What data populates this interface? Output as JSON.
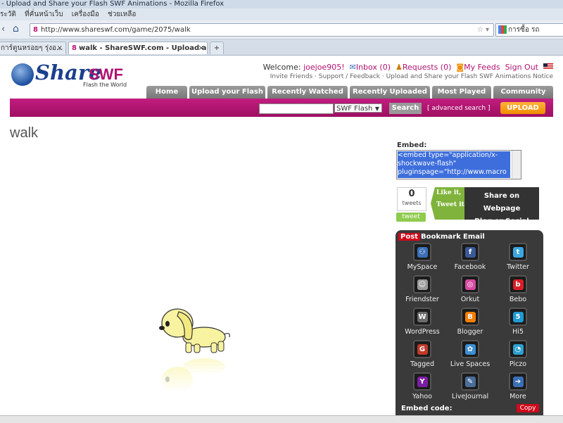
{
  "browser": {
    "title": "- Upload and Share your Flash SWF Animations - Mozilla Firefox",
    "menu": [
      "ระวัติ",
      "ที่คั่นหน้าเว็บ",
      "เครื่องมือ",
      "ช่วยเหลือ"
    ],
    "url": "http://www.shareswf.com/game/2075/walk",
    "search_text": "การซื้อ รถ",
    "tabs": [
      {
        "label": "การ์ตูนหรอยๆ รุ่งอ..."
      },
      {
        "label": "walk - ShareSWF.com - Upload an..."
      }
    ],
    "new_tab": "+"
  },
  "site": {
    "logo_share": "Share",
    "logo_swf": "SWF",
    "tagline": "Flash the World",
    "welcome": "Welcome:",
    "username": "joejoe905!",
    "inbox": "Inbox (0)",
    "requests": "Requests (0)",
    "feeds": "My Feeds",
    "signout": "Sign Out",
    "subline": "Invite Friends · Support / Feedback · Upload and Share your Flash SWF Animations Notice",
    "nav": [
      "Home",
      "Upload your Flash",
      "Recently Watched",
      "Recently Uploaded",
      "Most Played",
      "Community"
    ],
    "search_select": "SWF Flash",
    "search_btn": "Search",
    "advanced": "[ advanced search ]",
    "upload": "UPLOAD",
    "page_title": "walk"
  },
  "embed": {
    "label": "Embed:",
    "code": "<embed type=\"application/x-shockwave-flash\" pluginspage=\"http://www.macro"
  },
  "tweet": {
    "count": "0",
    "count_label": "tweets",
    "button": "tweet",
    "like_line1": "Like it,",
    "like_line2": "Tweet it",
    "share_line1": "Share on Webpage",
    "share_line2": "Blog or Social Network"
  },
  "bookmark": {
    "tabs": [
      "Post",
      "Bookmark",
      "Email"
    ],
    "services": [
      {
        "label": "MySpace",
        "icon": "myspace-icon",
        "color": "#3b6fb6"
      },
      {
        "label": "Facebook",
        "icon": "facebook-icon",
        "color": "#3b5998"
      },
      {
        "label": "Twitter",
        "icon": "twitter-icon",
        "color": "#3aa7e0"
      },
      {
        "label": "Friendster",
        "icon": "friendster-icon",
        "color": "#9a9a9a"
      },
      {
        "label": "Orkut",
        "icon": "orkut-icon",
        "color": "#d64aa1"
      },
      {
        "label": "Bebo",
        "icon": "bebo-icon",
        "color": "#d91f28"
      },
      {
        "label": "WordPress",
        "icon": "wordpress-icon",
        "color": "#6b6b6b"
      },
      {
        "label": "Blogger",
        "icon": "blogger-icon",
        "color": "#f57d00"
      },
      {
        "label": "Hi5",
        "icon": "hi5-icon",
        "color": "#1e9ad6"
      },
      {
        "label": "Tagged",
        "icon": "tagged-icon",
        "color": "#c0392b"
      },
      {
        "label": "Live Spaces",
        "icon": "livespaces-icon",
        "color": "#3d8fd1"
      },
      {
        "label": "Piczo",
        "icon": "piczo-icon",
        "color": "#2e9fd0"
      },
      {
        "label": "Yahoo",
        "icon": "yahoo-icon",
        "color": "#7b1fa2"
      },
      {
        "label": "LiveJournal",
        "icon": "livejournal-icon",
        "color": "#4a6e9a"
      },
      {
        "label": "More",
        "icon": "more-icon",
        "color": "#3b6fb6"
      }
    ],
    "embed_code": "Embed code:",
    "copy": "Copy"
  }
}
